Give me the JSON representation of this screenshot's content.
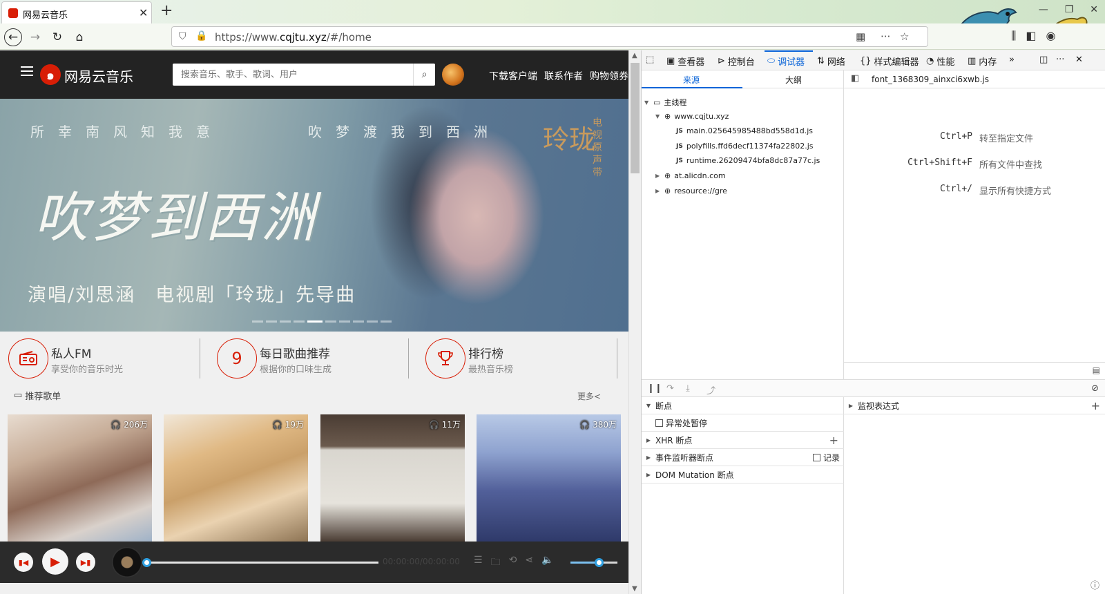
{
  "browser": {
    "tab_title": "网易云音乐",
    "url_prefix": "https://www.",
    "url_domain": "cqjtu.xyz",
    "url_suffix": "/#/home"
  },
  "app": {
    "brand": "网易云音乐",
    "search_placeholder": "搜索音乐、歌手、歌词、用户",
    "header_links": [
      "下载客户端",
      "联系作者",
      "购物领券"
    ]
  },
  "banner": {
    "lyric_left": "所幸南风知我意",
    "lyric_right": "吹梦渡我到西洲",
    "title": "吹梦到西洲",
    "subtitle": "演唱/刘思涵　电视剧「玲珑」先导曲",
    "seal": "玲珑",
    "vertical": "电视原声带",
    "slide_count": 10,
    "active_slide": 5
  },
  "features": [
    {
      "title": "私人FM",
      "subtitle": "享受你的音乐时光",
      "icon": "radio-icon"
    },
    {
      "title": "每日歌曲推荐",
      "subtitle": "根据你的口味生成",
      "icon_text": "9"
    },
    {
      "title": "排行榜",
      "subtitle": "最热音乐榜",
      "icon": "trophy-icon"
    }
  ],
  "section": {
    "title": "推荐歌单",
    "more": "更多<"
  },
  "playlists": [
    {
      "count": "206万"
    },
    {
      "count": "19万"
    },
    {
      "count": "11万"
    },
    {
      "count": "380万"
    }
  ],
  "player": {
    "time": "00:00:00/00:00:00",
    "progress": 0,
    "volume": 0.62
  },
  "devtools": {
    "tabs": [
      "查看器",
      "控制台",
      "调试器",
      "网络",
      "样式编辑器",
      "性能",
      "内存"
    ],
    "active_tab": "调试器",
    "source_tabs": [
      "来源",
      "大纲"
    ],
    "tree": {
      "root": "主线程",
      "domain": "www.cqjtu.xyz",
      "files": [
        "main.025645985488bd558d1d.js",
        "polyfills.ffd6decf11374fa22802.js",
        "runtime.26209474bfa8dc87a77c.js"
      ],
      "other": [
        "at.alicdn.com",
        "resource://gre"
      ]
    },
    "open_file": "font_1368309_ainxci6xwb.js",
    "shortcuts": [
      {
        "key": "Ctrl+P",
        "label": "转至指定文件"
      },
      {
        "key": "Ctrl+Shift+F",
        "label": "所有文件中查找"
      },
      {
        "key": "Ctrl+/",
        "label": "显示所有快捷方式"
      }
    ],
    "breakpoints": {
      "title": "断点",
      "pause_exceptions": "异常处暂停",
      "xhr": "XHR 断点",
      "events": "事件监听器断点",
      "log": "记录",
      "dom": "DOM Mutation 断点"
    },
    "watch": "监视表达式"
  },
  "colors": {
    "accent": "#d81e06",
    "devtools_blue": "#0a64d8",
    "header_bg": "#232323"
  }
}
